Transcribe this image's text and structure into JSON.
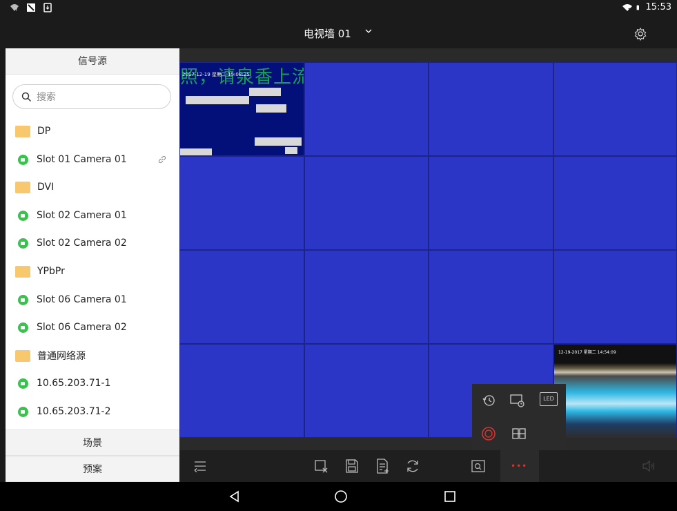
{
  "status_bar": {
    "time": "15:53"
  },
  "header": {
    "title": "电视墙 01"
  },
  "sidebar": {
    "signal_source_tab": "信号源",
    "search_placeholder": "搜索",
    "items": [
      {
        "type": "folder",
        "label": "DP"
      },
      {
        "type": "camera",
        "label": "Slot 01 Camera 01",
        "linked": true
      },
      {
        "type": "folder",
        "label": "DVI"
      },
      {
        "type": "camera",
        "label": "Slot 02 Camera 01"
      },
      {
        "type": "camera",
        "label": "Slot 02 Camera 02"
      },
      {
        "type": "folder",
        "label": "YPbPr"
      },
      {
        "type": "camera",
        "label": "Slot 06 Camera 01"
      },
      {
        "type": "camera",
        "label": "Slot 06 Camera 02"
      },
      {
        "type": "folder",
        "label": "普通网络源"
      },
      {
        "type": "camera",
        "label": "10.65.203.71-1"
      },
      {
        "type": "camera",
        "label": "10.65.203.71-2"
      }
    ],
    "scene_tab": "场景",
    "plan_tab": "预案"
  },
  "wall": {
    "rows": 4,
    "cols": 4,
    "feed1": {
      "timestamp": "2017-12-19 星期二 15:08:25",
      "overlay_text": "照，请泉香上流"
    },
    "feed2": {
      "timestamp": "12-19-2017 星期二 14:54:09"
    }
  },
  "popup": {
    "led_label": "LED"
  },
  "toolbar": {
    "more_label": "•••"
  },
  "colors": {
    "accent_green": "#39c24c",
    "wall_blue": "#2b36c7",
    "folder_yellow": "#f7c86e",
    "alert_red": "#d8332e"
  },
  "icons": {
    "status_left": [
      "wifi-question-icon",
      "no-sim-icon",
      "download-icon"
    ],
    "status_right": [
      "wifi-x-icon",
      "battery-icon"
    ],
    "toolbar": [
      "collapse-icon",
      "close-window-icon",
      "save-icon",
      "add-doc-icon",
      "refresh-icon",
      "zoom-screen-icon",
      "more-icon",
      "volume-icon"
    ],
    "popup": [
      "history-icon",
      "screen-timer-icon",
      "led-icon",
      "record-icon",
      "split-icon"
    ],
    "nav": [
      "back-icon",
      "home-icon",
      "recents-icon"
    ]
  }
}
